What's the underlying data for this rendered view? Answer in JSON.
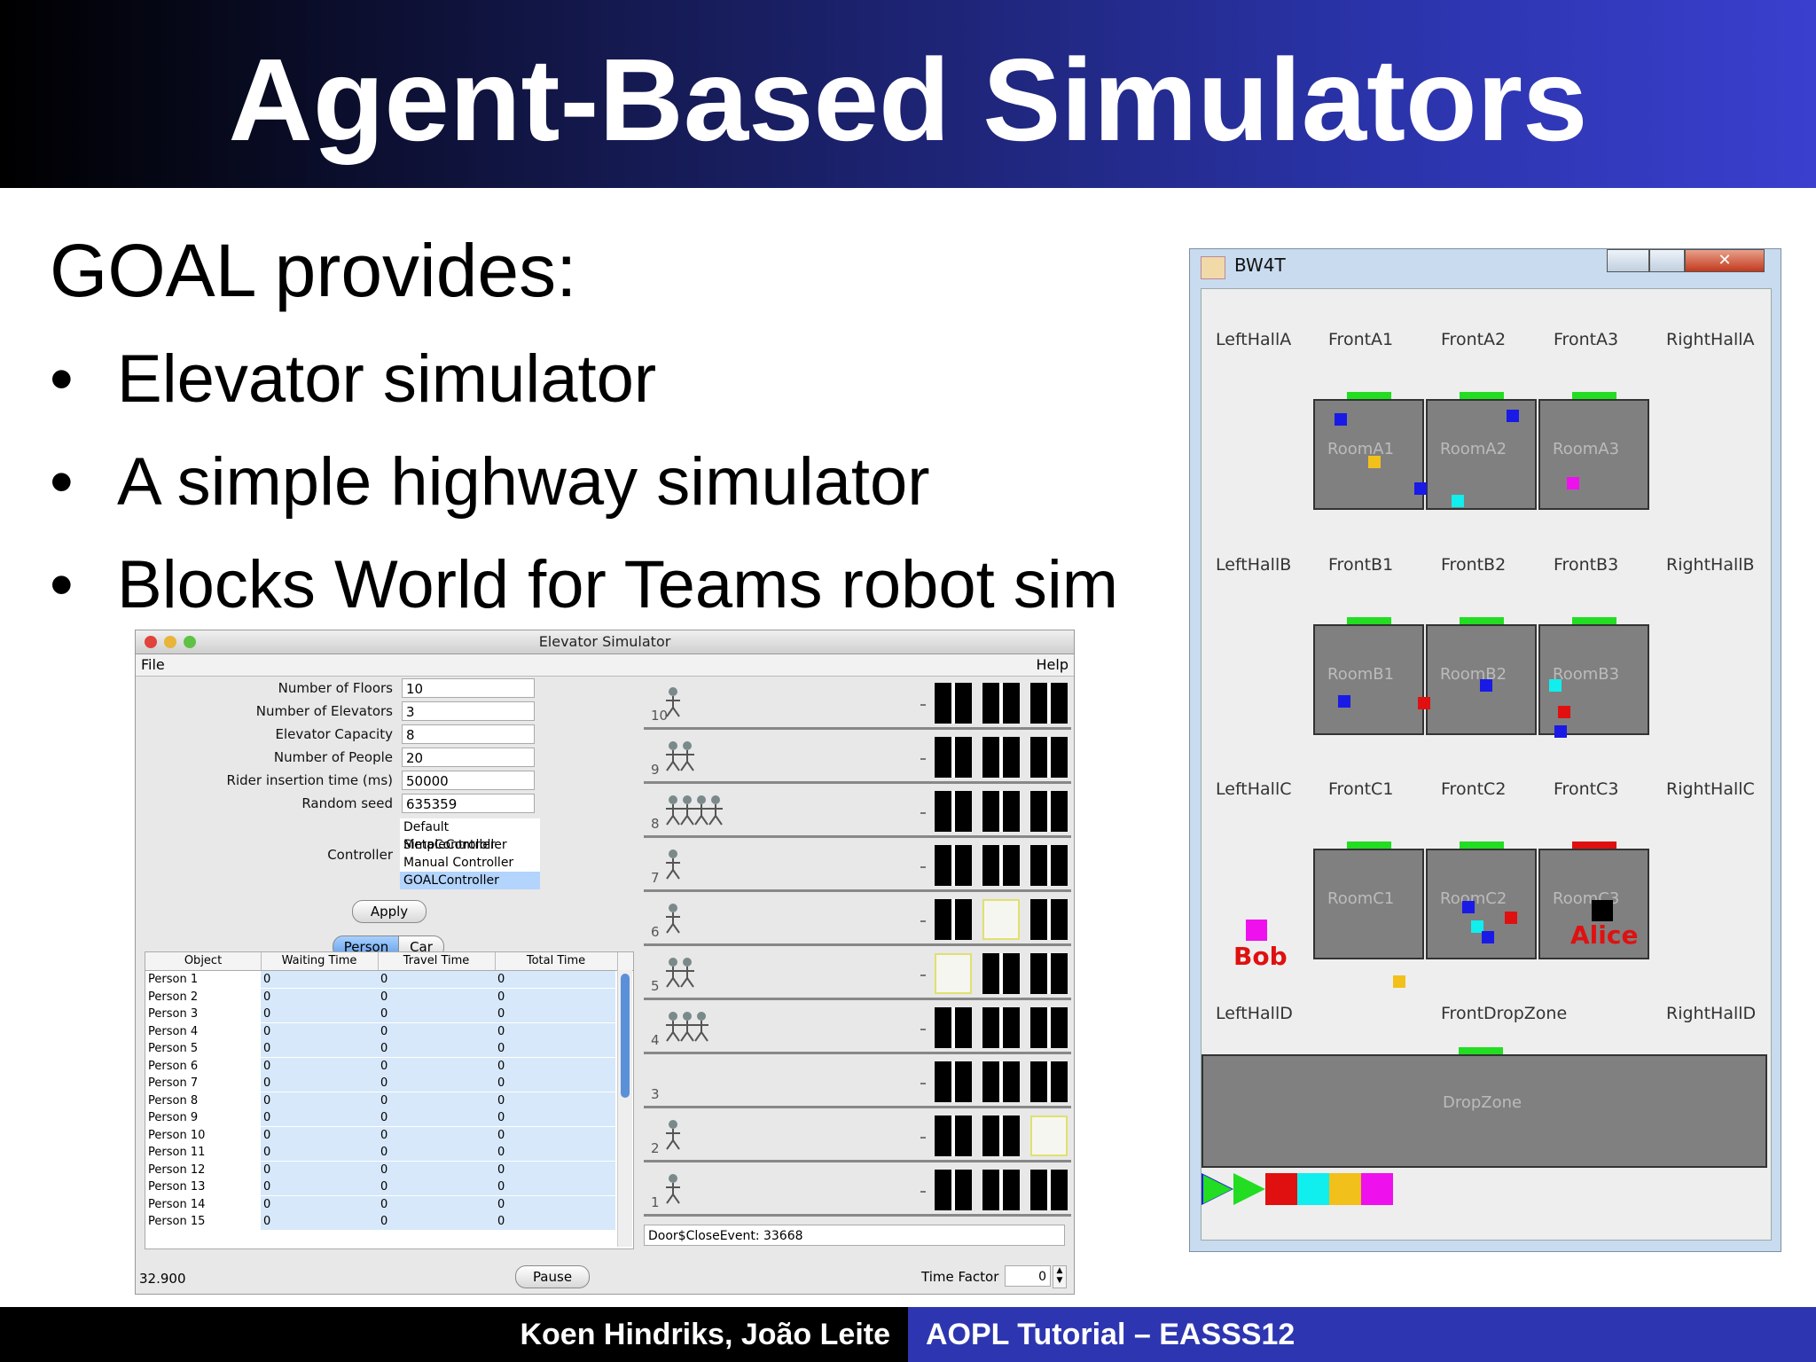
{
  "slide": {
    "title": "Agent-Based Simulators",
    "heading": "GOAL provides:",
    "bullets": [
      "Elevator simulator",
      "A simple highway simulator",
      "Blocks World for Teams robot sim"
    ],
    "bullet_char": "•",
    "footer_authors": "Koen Hindriks, João Leite",
    "footer_course": "AOPL Tutorial – EASSS12"
  },
  "elevator": {
    "window_title": "Elevator Simulator",
    "menu": {
      "file": "File",
      "help": "Help"
    },
    "fields": [
      {
        "label": "Number of Floors",
        "value": "10"
      },
      {
        "label": "Number of Elevators",
        "value": "3"
      },
      {
        "label": "Elevator Capacity",
        "value": "8"
      },
      {
        "label": "Number of People",
        "value": "20"
      },
      {
        "label": "Rider insertion time (ms)",
        "value": "50000"
      },
      {
        "label": "Random seed",
        "value": "635359"
      }
    ],
    "controller_label": "Controller",
    "controller_options": [
      "Default MetaController",
      "SimpleController",
      "Manual Controller",
      "GOALController"
    ],
    "controller_selected": "GOALController",
    "apply_label": "Apply",
    "tabs": [
      "Person",
      "Car"
    ],
    "table_headers": [
      "Object",
      "Waiting Time",
      "Travel Time",
      "Total Time"
    ],
    "table_rows": [
      [
        "Person 1",
        "0",
        "0",
        "0"
      ],
      [
        "Person 2",
        "0",
        "0",
        "0"
      ],
      [
        "Person 3",
        "0",
        "0",
        "0"
      ],
      [
        "Person 4",
        "0",
        "0",
        "0"
      ],
      [
        "Person 5",
        "0",
        "0",
        "0"
      ],
      [
        "Person 6",
        "0",
        "0",
        "0"
      ],
      [
        "Person 7",
        "0",
        "0",
        "0"
      ],
      [
        "Person 8",
        "0",
        "0",
        "0"
      ],
      [
        "Person 9",
        "0",
        "0",
        "0"
      ],
      [
        "Person 10",
        "0",
        "0",
        "0"
      ],
      [
        "Person 11",
        "0",
        "0",
        "0"
      ],
      [
        "Person 12",
        "0",
        "0",
        "0"
      ],
      [
        "Person 13",
        "0",
        "0",
        "0"
      ],
      [
        "Person 14",
        "0",
        "0",
        "0"
      ],
      [
        "Person 15",
        "0",
        "0",
        "0"
      ]
    ],
    "floor_numbers": [
      "10",
      "9",
      "8",
      "7",
      "6",
      "5",
      "4",
      "3",
      "2",
      "1"
    ],
    "event_text": "Door$CloseEvent: 33668",
    "time": "32.900",
    "pause_label": "Pause",
    "time_factor_label": "Time Factor",
    "time_factor_value": "0"
  },
  "bw4t": {
    "window_title": "BW4T",
    "hall_rows": [
      [
        "LeftHallA",
        "FrontA1",
        "FrontA2",
        "FrontA3",
        "RightHallA"
      ],
      [
        "LeftHallB",
        "FrontB1",
        "FrontB2",
        "FrontB3",
        "RightHallB"
      ],
      [
        "LeftHallC",
        "FrontC1",
        "FrontC2",
        "FrontC3",
        "RightHallC"
      ]
    ],
    "rooms": [
      [
        "RoomA1",
        "RoomA2",
        "RoomA3"
      ],
      [
        "RoomB1",
        "RoomB2",
        "RoomB3"
      ],
      [
        "RoomC1",
        "RoomC2",
        "RoomC3"
      ]
    ],
    "bottom_row": [
      "LeftHallD",
      "FrontDropZone",
      "RightHallD"
    ],
    "dropzone": "DropZone",
    "bots": [
      "Bob",
      "Alice"
    ],
    "colors": {
      "blue": "#1a1ae6",
      "red": "#e01010",
      "cyan": "#11eeee",
      "yellow": "#f2c01a",
      "magenta": "#ee11ee",
      "green": "#22dd22"
    },
    "sequence_colors": [
      "#e01010",
      "#11eeee",
      "#f2c01a",
      "#ee11ee"
    ]
  }
}
